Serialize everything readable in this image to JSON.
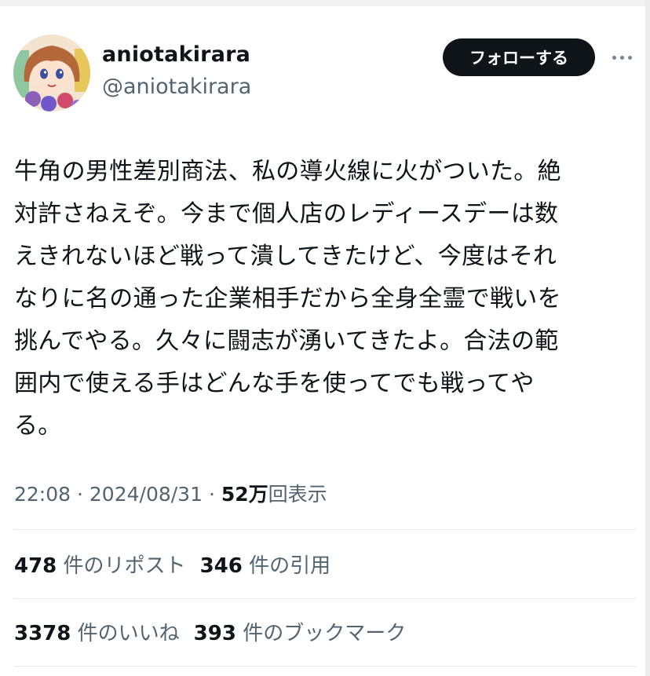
{
  "author": {
    "display_name": "aniotakirara",
    "handle": "@aniotakirara",
    "avatar_icon": "anime-girl-avatar-icon"
  },
  "header": {
    "follow_label": "フォローする",
    "more_icon": "more-dots-icon"
  },
  "tweet": {
    "lines": [
      "牛角の男性差別商法、私の導火線に火がついた。絶",
      "対許さねえぞ。今まで個人店のレディースデーは数",
      "えきれないほど戦って潰してきたけど、今度はそれ",
      "なりに名の通った企業相手だから全身全霊で戦いを",
      "挑んでやる。久々に闘志が湧いてきたよ。合法の範",
      "囲内で使える手はどんな手を使ってでも戦ってや",
      "る。"
    ]
  },
  "meta": {
    "time": "22:08",
    "separator": "·",
    "date": "2024/08/31",
    "views_count": "52万",
    "views_label": "回表示"
  },
  "stats": {
    "reposts_count": "478",
    "reposts_label": "件のリポスト",
    "quotes_count": "346",
    "quotes_label": "件の引用",
    "likes_count": "3378",
    "likes_label": "件のいいね",
    "bookmarks_count": "393",
    "bookmarks_label": "件のブックマーク"
  },
  "colors": {
    "text": "#0f1419",
    "secondary": "#536471",
    "follow_bg": "#0f1419",
    "divider": "#e6e9eb"
  }
}
